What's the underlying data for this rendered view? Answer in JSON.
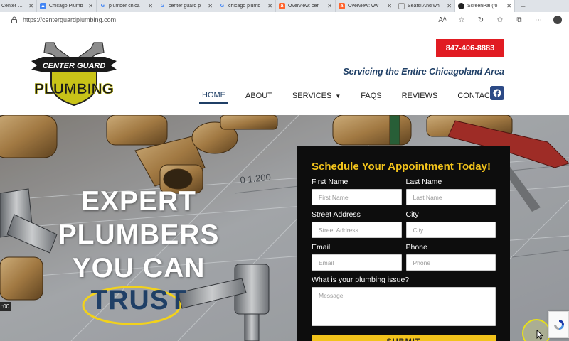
{
  "browser": {
    "tabs": [
      {
        "title": "Center Guard",
        "favicon": "site-icon",
        "active": false
      },
      {
        "title": "Chicago Plumb",
        "favicon": "ads-icon",
        "active": false
      },
      {
        "title": "plumber chica",
        "favicon": "google-icon",
        "active": false
      },
      {
        "title": "center guard p",
        "favicon": "google-icon",
        "active": false
      },
      {
        "title": "chicago plumb",
        "favicon": "google-icon",
        "active": false
      },
      {
        "title": "Overview: cen",
        "favicon": "semrush-icon",
        "active": false
      },
      {
        "title": "Overview: ww",
        "favicon": "semrush-icon",
        "active": false
      },
      {
        "title": "Seats! And wh",
        "favicon": "page-icon",
        "active": false
      },
      {
        "title": "ScreenPal (fo",
        "favicon": "screenpal-icon",
        "active": true
      }
    ],
    "url": "https://centerguardplumbing.com"
  },
  "header": {
    "logo_text_top": "CENTER GUARD",
    "logo_text_bottom": "PLUMBING",
    "phone": "847-406-8883",
    "tagline": "Servicing the Entire Chicagoland Area",
    "nav": [
      {
        "label": "HOME",
        "active": true
      },
      {
        "label": "ABOUT",
        "active": false
      },
      {
        "label": "SERVICES",
        "active": false,
        "dropdown": true
      },
      {
        "label": "FAQS",
        "active": false
      },
      {
        "label": "REVIEWS",
        "active": false
      },
      {
        "label": "CONTACT",
        "active": false
      }
    ],
    "social_icon": "facebook-icon"
  },
  "hero": {
    "lines": [
      "EXPERT",
      "PLUMBERS",
      "YOU CAN"
    ],
    "highlight": "TRUST",
    "time_badge": ":00",
    "blueprint_text": "0 1.200"
  },
  "form": {
    "title": "Schedule Your Appointment Today!",
    "first_name": {
      "label": "First Name",
      "placeholder": "First Name"
    },
    "last_name": {
      "label": "Last Name",
      "placeholder": "Last Name"
    },
    "street": {
      "label": "Street Address",
      "placeholder": "Street Address"
    },
    "city": {
      "label": "City",
      "placeholder": "City"
    },
    "email": {
      "label": "Email",
      "placeholder": "Email"
    },
    "phone": {
      "label": "Phone",
      "placeholder": "Phone"
    },
    "issue": {
      "label": "What is your plumbing issue?",
      "placeholder": "Message"
    },
    "submit": "SUBMIT"
  },
  "colors": {
    "brand_red": "#e11b22",
    "brand_navy": "#1f3f66",
    "accent_yellow": "#f2c31b",
    "form_bg": "#0d0d0d"
  }
}
